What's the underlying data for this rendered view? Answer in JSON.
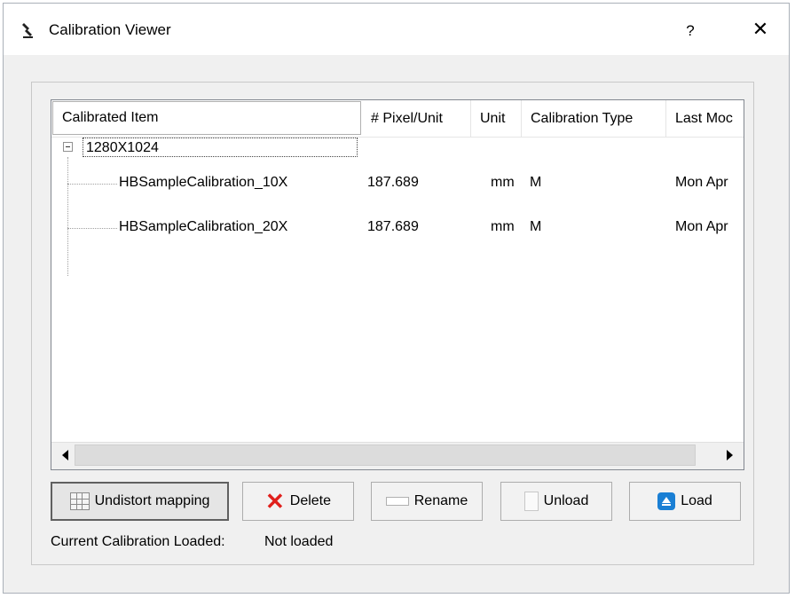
{
  "window": {
    "title": "Calibration Viewer",
    "help_label": "?",
    "close_label": "✕"
  },
  "tree": {
    "columns": [
      "Calibrated Item",
      "# Pixel/Unit",
      "Unit",
      "Calibration Type",
      "Last Moc"
    ],
    "group": {
      "label": "1280X1024",
      "expanded": true
    },
    "rows": [
      {
        "name": "HBSampleCalibration_10X",
        "pixel_per_unit": "187.689",
        "unit": "mm",
        "type": "M",
        "last_modified": "Mon Apr"
      },
      {
        "name": "HBSampleCalibration_20X",
        "pixel_per_unit": "187.689",
        "unit": "mm",
        "type": "M",
        "last_modified": "Mon Apr"
      }
    ]
  },
  "buttons": {
    "undistort": "Undistort mapping",
    "delete": "Delete",
    "rename": "Rename",
    "unload": "Unload",
    "load": "Load"
  },
  "status": {
    "label": "Current Calibration Loaded:",
    "value": "Not loaded"
  },
  "icons": {
    "app": "microscope-icon",
    "undistort": "grid-icon",
    "delete": "red-x-icon",
    "rename": "rename-icon",
    "unload": "document-icon",
    "load": "load-icon"
  },
  "colors": {
    "delete_icon": "#e0201c",
    "load_icon": "#1a7fd4"
  }
}
